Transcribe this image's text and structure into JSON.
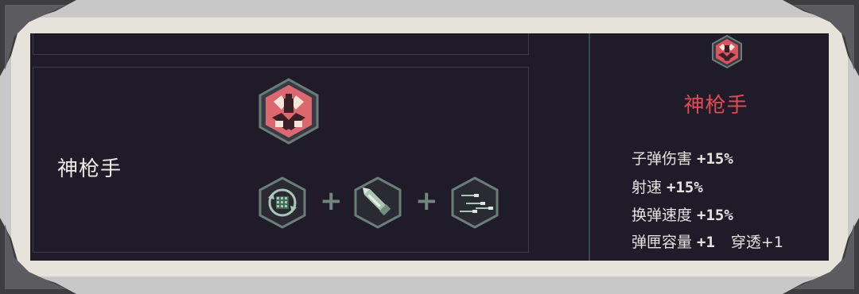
{
  "skill": {
    "name": "神枪手"
  },
  "components": [
    {
      "icon": "reload-icon"
    },
    {
      "icon": "bullet-icon"
    },
    {
      "icon": "multi-shot-icon"
    }
  ],
  "plus_sign": "+",
  "side_panel": {
    "title": "神枪手",
    "stats": [
      {
        "label": "子弹伤害",
        "value": "+15%",
        "extra": ""
      },
      {
        "label": "射速",
        "value": "+15%",
        "extra": ""
      },
      {
        "label": "换弹速度",
        "value": "+15%",
        "extra": ""
      },
      {
        "label": "弹匣容量",
        "value": "+1",
        "extra": "穿透+1"
      }
    ]
  },
  "colors": {
    "panel_bg": "#1f1b29",
    "title_red": "#e14b56",
    "hex_border": "#6b7d78",
    "icon_green": "#a9c7b2",
    "frame": "#e6e4da"
  }
}
